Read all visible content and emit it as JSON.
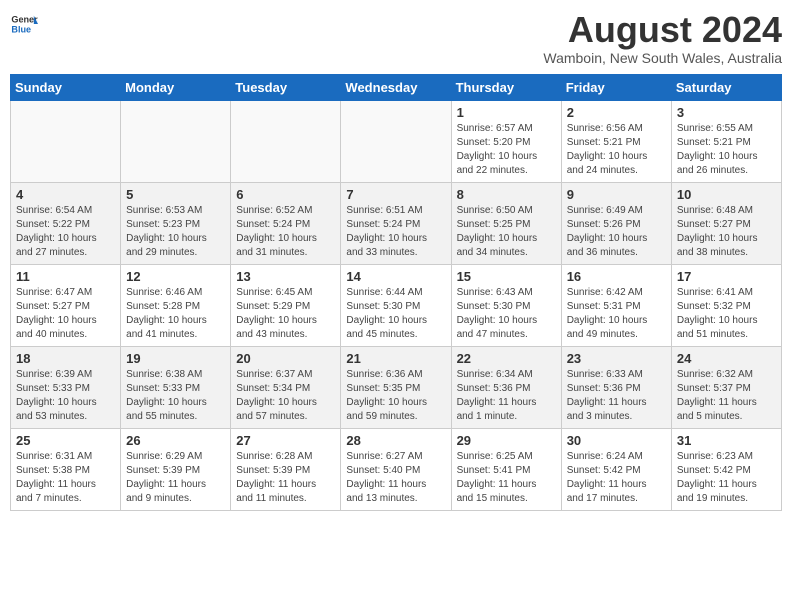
{
  "header": {
    "logo_general": "General",
    "logo_blue": "Blue",
    "title": "August 2024",
    "subtitle": "Wamboin, New South Wales, Australia"
  },
  "calendar": {
    "weekdays": [
      "Sunday",
      "Monday",
      "Tuesday",
      "Wednesday",
      "Thursday",
      "Friday",
      "Saturday"
    ],
    "rows": [
      [
        {
          "day": "",
          "info": ""
        },
        {
          "day": "",
          "info": ""
        },
        {
          "day": "",
          "info": ""
        },
        {
          "day": "",
          "info": ""
        },
        {
          "day": "1",
          "info": "Sunrise: 6:57 AM\nSunset: 5:20 PM\nDaylight: 10 hours\nand 22 minutes."
        },
        {
          "day": "2",
          "info": "Sunrise: 6:56 AM\nSunset: 5:21 PM\nDaylight: 10 hours\nand 24 minutes."
        },
        {
          "day": "3",
          "info": "Sunrise: 6:55 AM\nSunset: 5:21 PM\nDaylight: 10 hours\nand 26 minutes."
        }
      ],
      [
        {
          "day": "4",
          "info": "Sunrise: 6:54 AM\nSunset: 5:22 PM\nDaylight: 10 hours\nand 27 minutes."
        },
        {
          "day": "5",
          "info": "Sunrise: 6:53 AM\nSunset: 5:23 PM\nDaylight: 10 hours\nand 29 minutes."
        },
        {
          "day": "6",
          "info": "Sunrise: 6:52 AM\nSunset: 5:24 PM\nDaylight: 10 hours\nand 31 minutes."
        },
        {
          "day": "7",
          "info": "Sunrise: 6:51 AM\nSunset: 5:24 PM\nDaylight: 10 hours\nand 33 minutes."
        },
        {
          "day": "8",
          "info": "Sunrise: 6:50 AM\nSunset: 5:25 PM\nDaylight: 10 hours\nand 34 minutes."
        },
        {
          "day": "9",
          "info": "Sunrise: 6:49 AM\nSunset: 5:26 PM\nDaylight: 10 hours\nand 36 minutes."
        },
        {
          "day": "10",
          "info": "Sunrise: 6:48 AM\nSunset: 5:27 PM\nDaylight: 10 hours\nand 38 minutes."
        }
      ],
      [
        {
          "day": "11",
          "info": "Sunrise: 6:47 AM\nSunset: 5:27 PM\nDaylight: 10 hours\nand 40 minutes."
        },
        {
          "day": "12",
          "info": "Sunrise: 6:46 AM\nSunset: 5:28 PM\nDaylight: 10 hours\nand 41 minutes."
        },
        {
          "day": "13",
          "info": "Sunrise: 6:45 AM\nSunset: 5:29 PM\nDaylight: 10 hours\nand 43 minutes."
        },
        {
          "day": "14",
          "info": "Sunrise: 6:44 AM\nSunset: 5:30 PM\nDaylight: 10 hours\nand 45 minutes."
        },
        {
          "day": "15",
          "info": "Sunrise: 6:43 AM\nSunset: 5:30 PM\nDaylight: 10 hours\nand 47 minutes."
        },
        {
          "day": "16",
          "info": "Sunrise: 6:42 AM\nSunset: 5:31 PM\nDaylight: 10 hours\nand 49 minutes."
        },
        {
          "day": "17",
          "info": "Sunrise: 6:41 AM\nSunset: 5:32 PM\nDaylight: 10 hours\nand 51 minutes."
        }
      ],
      [
        {
          "day": "18",
          "info": "Sunrise: 6:39 AM\nSunset: 5:33 PM\nDaylight: 10 hours\nand 53 minutes."
        },
        {
          "day": "19",
          "info": "Sunrise: 6:38 AM\nSunset: 5:33 PM\nDaylight: 10 hours\nand 55 minutes."
        },
        {
          "day": "20",
          "info": "Sunrise: 6:37 AM\nSunset: 5:34 PM\nDaylight: 10 hours\nand 57 minutes."
        },
        {
          "day": "21",
          "info": "Sunrise: 6:36 AM\nSunset: 5:35 PM\nDaylight: 10 hours\nand 59 minutes."
        },
        {
          "day": "22",
          "info": "Sunrise: 6:34 AM\nSunset: 5:36 PM\nDaylight: 11 hours\nand 1 minute."
        },
        {
          "day": "23",
          "info": "Sunrise: 6:33 AM\nSunset: 5:36 PM\nDaylight: 11 hours\nand 3 minutes."
        },
        {
          "day": "24",
          "info": "Sunrise: 6:32 AM\nSunset: 5:37 PM\nDaylight: 11 hours\nand 5 minutes."
        }
      ],
      [
        {
          "day": "25",
          "info": "Sunrise: 6:31 AM\nSunset: 5:38 PM\nDaylight: 11 hours\nand 7 minutes."
        },
        {
          "day": "26",
          "info": "Sunrise: 6:29 AM\nSunset: 5:39 PM\nDaylight: 11 hours\nand 9 minutes."
        },
        {
          "day": "27",
          "info": "Sunrise: 6:28 AM\nSunset: 5:39 PM\nDaylight: 11 hours\nand 11 minutes."
        },
        {
          "day": "28",
          "info": "Sunrise: 6:27 AM\nSunset: 5:40 PM\nDaylight: 11 hours\nand 13 minutes."
        },
        {
          "day": "29",
          "info": "Sunrise: 6:25 AM\nSunset: 5:41 PM\nDaylight: 11 hours\nand 15 minutes."
        },
        {
          "day": "30",
          "info": "Sunrise: 6:24 AM\nSunset: 5:42 PM\nDaylight: 11 hours\nand 17 minutes."
        },
        {
          "day": "31",
          "info": "Sunrise: 6:23 AM\nSunset: 5:42 PM\nDaylight: 11 hours\nand 19 minutes."
        }
      ]
    ]
  }
}
